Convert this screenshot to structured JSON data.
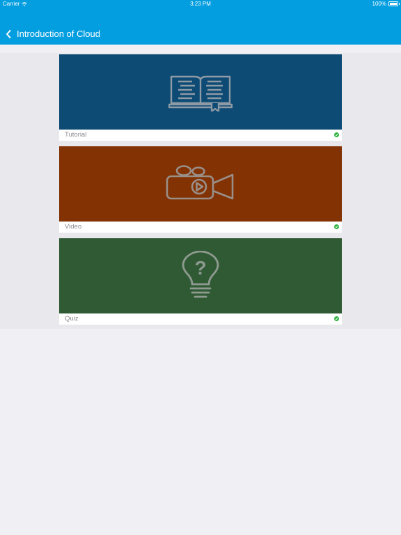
{
  "status_bar": {
    "carrier": "Carrier",
    "time": "3:23 PM",
    "battery": "100%"
  },
  "nav": {
    "title": "Introduction of Cloud",
    "back_icon": "chevron-left-icon"
  },
  "colors": {
    "nav_bg": "#039ee0",
    "tutorial_bg": "#0d4b74",
    "video_bg": "#823203",
    "quiz_bg": "#2f5a33",
    "check": "#2fb341"
  },
  "items": [
    {
      "label": "Tutorial",
      "icon": "open-book-icon",
      "completed": true
    },
    {
      "label": "Video",
      "icon": "video-camera-icon",
      "completed": true
    },
    {
      "label": "Quiz",
      "icon": "lightbulb-question-icon",
      "completed": true
    }
  ]
}
